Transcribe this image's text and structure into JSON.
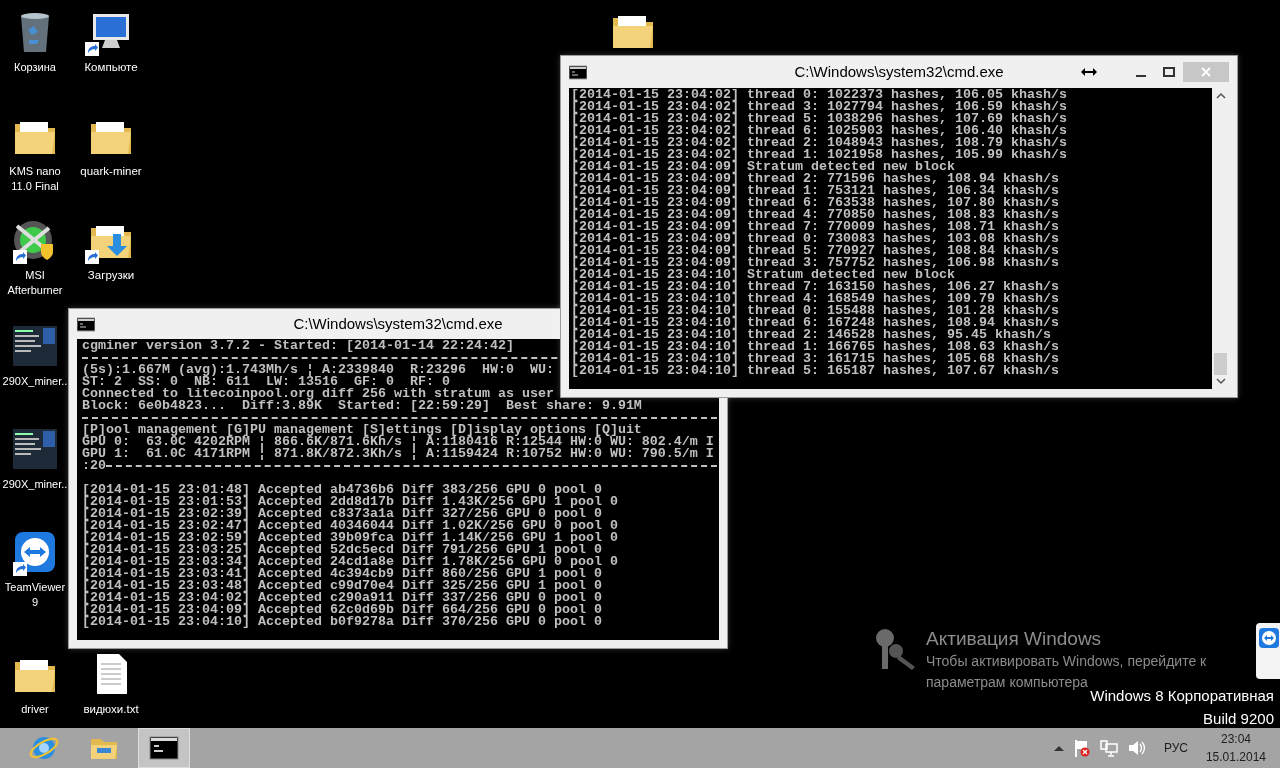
{
  "desktop_icons": [
    {
      "kind": "recycle-bin",
      "label": "Корзина",
      "shortcut": false
    },
    {
      "kind": "computer",
      "label": "Компьюте",
      "shortcut": true
    },
    {
      "kind": "folder",
      "label": "KMS nano 11.0 Final",
      "shortcut": false
    },
    {
      "kind": "folder",
      "label": "quark-miner",
      "shortcut": false
    },
    {
      "kind": "afterburner",
      "label": "MSI Afterburner",
      "shortcut": true
    },
    {
      "kind": "downloads",
      "label": "Загрузки",
      "shortcut": true
    },
    {
      "kind": "thumbnail",
      "label": "290X_miner..",
      "shortcut": false
    },
    {
      "kind": "thumbnail",
      "label": "290X_miner..",
      "shortcut": false
    },
    {
      "kind": "teamviewer",
      "label": "TeamViewer 9",
      "shortcut": true
    },
    {
      "kind": "folder",
      "label": "driver",
      "shortcut": false
    },
    {
      "kind": "textfile",
      "label": "видюхи.txt",
      "shortcut": false
    },
    {
      "kind": "folder",
      "shortcut": false
    }
  ],
  "windows": [
    {
      "title": "C:\\Windows\\system32\\cmd.exe",
      "scrollbar": false,
      "lines": [
        {
          "kind": "text",
          "text": "cgminer version 3.7.2 - Started: [2014-01-14 22:24:42]"
        },
        {
          "kind": "rule"
        },
        {
          "kind": "text",
          "text": "(5s):1.667M (avg):1.743Mh/s ¦ A:2339840  R:23296  HW:0  WU:"
        },
        {
          "kind": "text",
          "text": "ST: 2  SS: 0  NB: 611  LW: 13516  GF: 0  RF: 0"
        },
        {
          "kind": "text",
          "text": "Connected to litecoinpool.org diff 256 with stratum as user"
        },
        {
          "kind": "text",
          "text": "Block: 6e0b4823...  Diff:3.89K  Started: [22:59:29]  Best share: 9.91M"
        },
        {
          "kind": "rule"
        },
        {
          "kind": "text",
          "text": "[P]ool management [G]PU management [S]ettings [D]isplay options [Q]uit"
        },
        {
          "kind": "text",
          "text": "GPU 0:  63.0C 4202RPM ¦ 866.6K/871.6Kh/s ¦ A:1180416 R:12544 HW:0 WU: 802.4/m I"
        },
        {
          "kind": "text",
          "text": "GPU 1:  61.0C 4171RPM ¦ 871.8K/872.3Kh/s ¦ A:1159424 R:10752 HW:0 WU: 790.5/m I"
        },
        {
          "kind": "rule",
          "text": ":20"
        },
        {
          "kind": "blank"
        },
        {
          "kind": "text",
          "text": "[2014-01-15 23:01:48] Accepted ab4736b6 Diff 383/256 GPU 0 pool 0"
        },
        {
          "kind": "text",
          "text": "[2014-01-15 23:01:53] Accepted 2dd8d17b Diff 1.43K/256 GPU 1 pool 0"
        },
        {
          "kind": "text",
          "text": "[2014-01-15 23:02:39] Accepted c8373a1a Diff 327/256 GPU 0 pool 0"
        },
        {
          "kind": "text",
          "text": "[2014-01-15 23:02:47] Accepted 40346044 Diff 1.02K/256 GPU 0 pool 0"
        },
        {
          "kind": "text",
          "text": "[2014-01-15 23:02:59] Accepted 39b09fca Diff 1.14K/256 GPU 1 pool 0"
        },
        {
          "kind": "text",
          "text": "[2014-01-15 23:03:25] Accepted 52dc5ecd Diff 791/256 GPU 1 pool 0"
        },
        {
          "kind": "text",
          "text": "[2014-01-15 23:03:34] Accepted 24cd1a8e Diff 1.78K/256 GPU 0 pool 0"
        },
        {
          "kind": "text",
          "text": "[2014-01-15 23:03:41] Accepted 4c394cb9 Diff 860/256 GPU 1 pool 0"
        },
        {
          "kind": "text",
          "text": "[2014-01-15 23:03:48] Accepted c99d70e4 Diff 325/256 GPU 1 pool 0"
        },
        {
          "kind": "text",
          "text": "[2014-01-15 23:04:02] Accepted c290a911 Diff 337/256 GPU 0 pool 0"
        },
        {
          "kind": "text",
          "text": "[2014-01-15 23:04:09] Accepted 62c0d69b Diff 664/256 GPU 0 pool 0"
        },
        {
          "kind": "text",
          "text": "[2014-01-15 23:04:10] Accepted b0f9278a Diff 370/256 GPU 0 pool 0"
        }
      ]
    },
    {
      "title": "C:\\Windows\\system32\\cmd.exe",
      "scrollbar": true,
      "lines": [
        {
          "kind": "text",
          "text": "[2014-01-15 23:04:02] thread 0: 1022373 hashes, 106.05 khash/s"
        },
        {
          "kind": "text",
          "text": "[2014-01-15 23:04:02] thread 3: 1027794 hashes, 106.59 khash/s"
        },
        {
          "kind": "text",
          "text": "[2014-01-15 23:04:02] thread 5: 1038296 hashes, 107.69 khash/s"
        },
        {
          "kind": "text",
          "text": "[2014-01-15 23:04:02] thread 6: 1025903 hashes, 106.40 khash/s"
        },
        {
          "kind": "text",
          "text": "[2014-01-15 23:04:02] thread 2: 1048943 hashes, 108.79 khash/s"
        },
        {
          "kind": "text",
          "text": "[2014-01-15 23:04:02] thread 1: 1021958 hashes, 105.99 khash/s"
        },
        {
          "kind": "text",
          "text": "[2014-01-15 23:04:09] Stratum detected new block"
        },
        {
          "kind": "text",
          "text": "[2014-01-15 23:04:09] thread 2: 771596 hashes, 108.94 khash/s"
        },
        {
          "kind": "text",
          "text": "[2014-01-15 23:04:09] thread 1: 753121 hashes, 106.34 khash/s"
        },
        {
          "kind": "text",
          "text": "[2014-01-15 23:04:09] thread 6: 763538 hashes, 107.80 khash/s"
        },
        {
          "kind": "text",
          "text": "[2014-01-15 23:04:09] thread 4: 770850 hashes, 108.83 khash/s"
        },
        {
          "kind": "text",
          "text": "[2014-01-15 23:04:09] thread 7: 770009 hashes, 108.71 khash/s"
        },
        {
          "kind": "text",
          "text": "[2014-01-15 23:04:09] thread 0: 730083 hashes, 103.08 khash/s"
        },
        {
          "kind": "text",
          "text": "[2014-01-15 23:04:09] thread 5: 770927 hashes, 108.84 khash/s"
        },
        {
          "kind": "text",
          "text": "[2014-01-15 23:04:09] thread 3: 757752 hashes, 106.98 khash/s"
        },
        {
          "kind": "text",
          "text": "[2014-01-15 23:04:10] Stratum detected new block"
        },
        {
          "kind": "text",
          "text": "[2014-01-15 23:04:10] thread 7: 163150 hashes, 106.27 khash/s"
        },
        {
          "kind": "text",
          "text": "[2014-01-15 23:04:10] thread 4: 168549 hashes, 109.79 khash/s"
        },
        {
          "kind": "text",
          "text": "[2014-01-15 23:04:10] thread 0: 155488 hashes, 101.28 khash/s"
        },
        {
          "kind": "text",
          "text": "[2014-01-15 23:04:10] thread 6: 167248 hashes, 108.94 khash/s"
        },
        {
          "kind": "text",
          "text": "[2014-01-15 23:04:10] thread 2: 146528 hashes, 95.45 khash/s"
        },
        {
          "kind": "text",
          "text": "[2014-01-15 23:04:10] thread 1: 166765 hashes, 108.63 khash/s"
        },
        {
          "kind": "text",
          "text": "[2014-01-15 23:04:10] thread 3: 161715 hashes, 105.68 khash/s"
        },
        {
          "kind": "text",
          "text": "[2014-01-15 23:04:10] thread 5: 165187 hashes, 107.67 khash/s"
        }
      ]
    }
  ],
  "activation": {
    "title": "Активация Windows",
    "text": "Чтобы активировать Windows, перейдите к параметрам компьютера"
  },
  "edition": [
    "Windows 8 Корпоративная",
    "Build 9200"
  ],
  "taskbar": {
    "apps": [
      {
        "kind": "browser",
        "selected": false
      },
      {
        "kind": "explorer",
        "selected": false
      },
      {
        "kind": "console",
        "selected": true
      }
    ],
    "tray": {
      "language": "РУС",
      "time": "23:04",
      "date": "15.01.2014"
    }
  }
}
